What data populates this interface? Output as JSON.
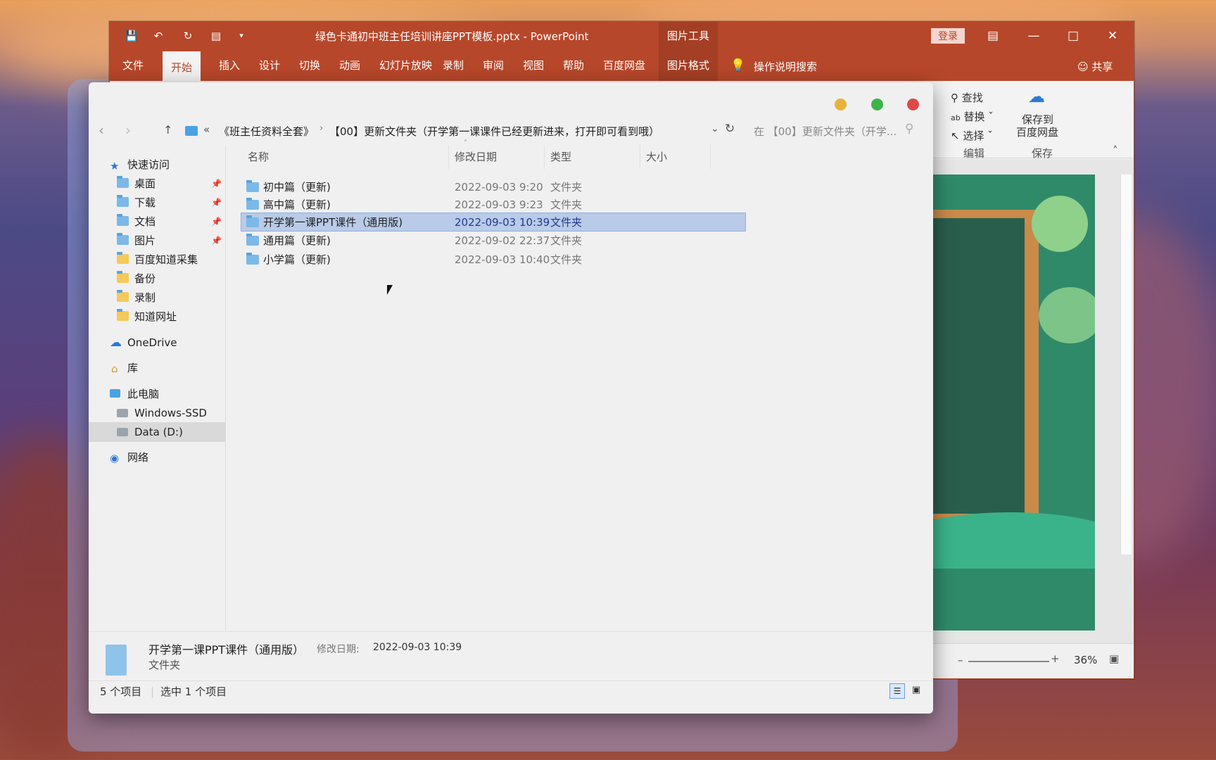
{
  "ppt": {
    "doc_title": "绿色卡通初中班主任培训讲座PPT模板.pptx  -  PowerPoint",
    "context_tab": "图片工具",
    "login": "登录",
    "tabs": [
      "文件",
      "开始",
      "插入",
      "设计",
      "切换",
      "动画",
      "幻灯片放映",
      "录制",
      "审阅",
      "视图",
      "帮助",
      "百度网盘",
      "图片格式"
    ],
    "search_hint": "操作说明搜索",
    "share": "共享",
    "ribbon": {
      "find": "查找",
      "replace": "替换",
      "select": "选择",
      "edit_group": "编辑",
      "save_to": "保存到",
      "baidu": "百度网盘",
      "save_group": "保存"
    },
    "zoom": "36%"
  },
  "explorer": {
    "breadcrumb": [
      "«",
      "《班主任资料全套》",
      "【00】更新文件夹（开学第一课课件已经更新进来，打开即可看到哦）"
    ],
    "search_placeholder": "在 【00】更新文件夹（开学...",
    "nav": [
      {
        "label": "快速访问",
        "icon": "star-icon"
      },
      {
        "label": "桌面",
        "icon": "desktop-folder-icon",
        "pinned": true
      },
      {
        "label": "下载",
        "icon": "download-folder-icon",
        "pinned": true
      },
      {
        "label": "文档",
        "icon": "documents-folder-icon",
        "pinned": true
      },
      {
        "label": "图片",
        "icon": "pictures-folder-icon",
        "pinned": true
      },
      {
        "label": "百度知道采集",
        "icon": "folder-icon"
      },
      {
        "label": "备份",
        "icon": "folder-icon"
      },
      {
        "label": "录制",
        "icon": "folder-icon"
      },
      {
        "label": "知道网址",
        "icon": "folder-icon"
      },
      {
        "label": "OneDrive",
        "icon": "cloud-icon"
      },
      {
        "label": "库",
        "icon": "library-icon"
      },
      {
        "label": "此电脑",
        "icon": "computer-icon"
      },
      {
        "label": "Windows-SSD (C:)",
        "icon": "drive-icon"
      },
      {
        "label": "Data (D:)",
        "icon": "drive-icon"
      },
      {
        "label": "网络",
        "icon": "network-icon"
      }
    ],
    "columns": [
      "名称",
      "修改日期",
      "类型",
      "大小"
    ],
    "files": [
      {
        "name": "初中篇（更新)",
        "date": "2022-09-03 9:20",
        "type": "文件夹"
      },
      {
        "name": "高中篇（更新)",
        "date": "2022-09-03 9:23",
        "type": "文件夹"
      },
      {
        "name": "开学第一课PPT课件（通用版)",
        "date": "2022-09-03 10:39",
        "type": "文件夹"
      },
      {
        "name": "通用篇（更新)",
        "date": "2022-09-02 22:37",
        "type": "文件夹"
      },
      {
        "name": "小学篇（更新)",
        "date": "2022-09-03 10:40",
        "type": "文件夹"
      }
    ],
    "details": {
      "name": "开学第一课PPT课件（通用版）",
      "date_label": "修改日期:",
      "date": "2022-09-03 10:39",
      "type": "文件夹"
    },
    "status": {
      "count": "5 个项目",
      "selected": "选中 1 个项目"
    }
  }
}
